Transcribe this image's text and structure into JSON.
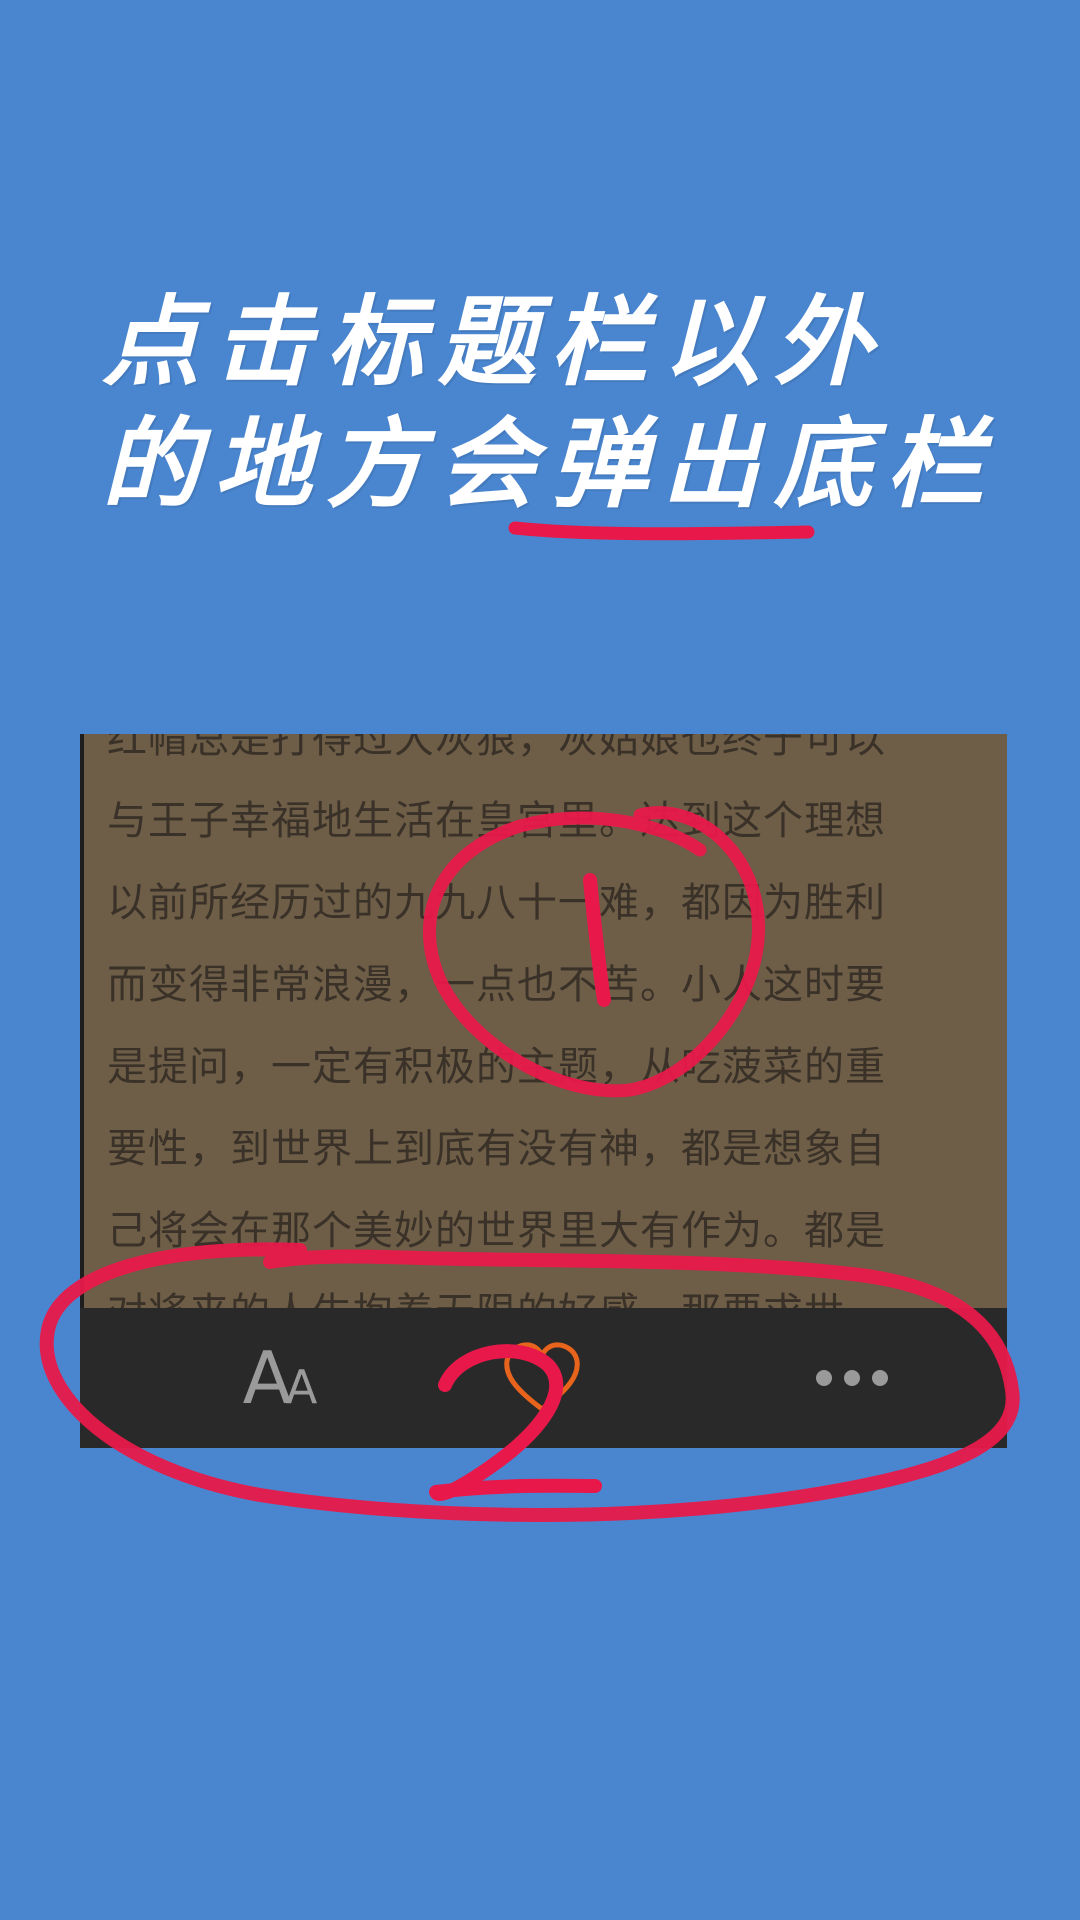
{
  "headline": {
    "line1": "点击标题栏以外",
    "line2": "的地方会弹出底栏"
  },
  "reader": {
    "lines": [
      "红帽总是打得过大灰狼，灰姑娘也终于可以",
      "与王子幸福地生活在皇宫里。达到这个理想",
      "以前所经历过的九九八十一难，都因为胜利",
      "而变得非常浪漫，一点也不苦。小人这时要",
      "是提问，一定有积极的主题，从吃菠菜的重",
      "要性，到世界上到底有没有神，都是想象自",
      "己将会在那个美妙的世界里大有作为。都是",
      "对将来的人生抱着无限的好感，那要求世"
    ]
  },
  "bottom_bar": {
    "font_icon": "font-size-icon",
    "font_glyph_big": "A",
    "font_glyph_small": "A",
    "favorite_icon": "heart-outline-icon",
    "more_icon": "more-dots-icon"
  },
  "annotations": {
    "marker_1": "1",
    "marker_2": "2",
    "color": "#E8194A"
  },
  "colors": {
    "background": "#4A86D0",
    "reader_bg": "#6E5E47",
    "bar_bg": "#2A2929",
    "heart": "#E8641C"
  }
}
